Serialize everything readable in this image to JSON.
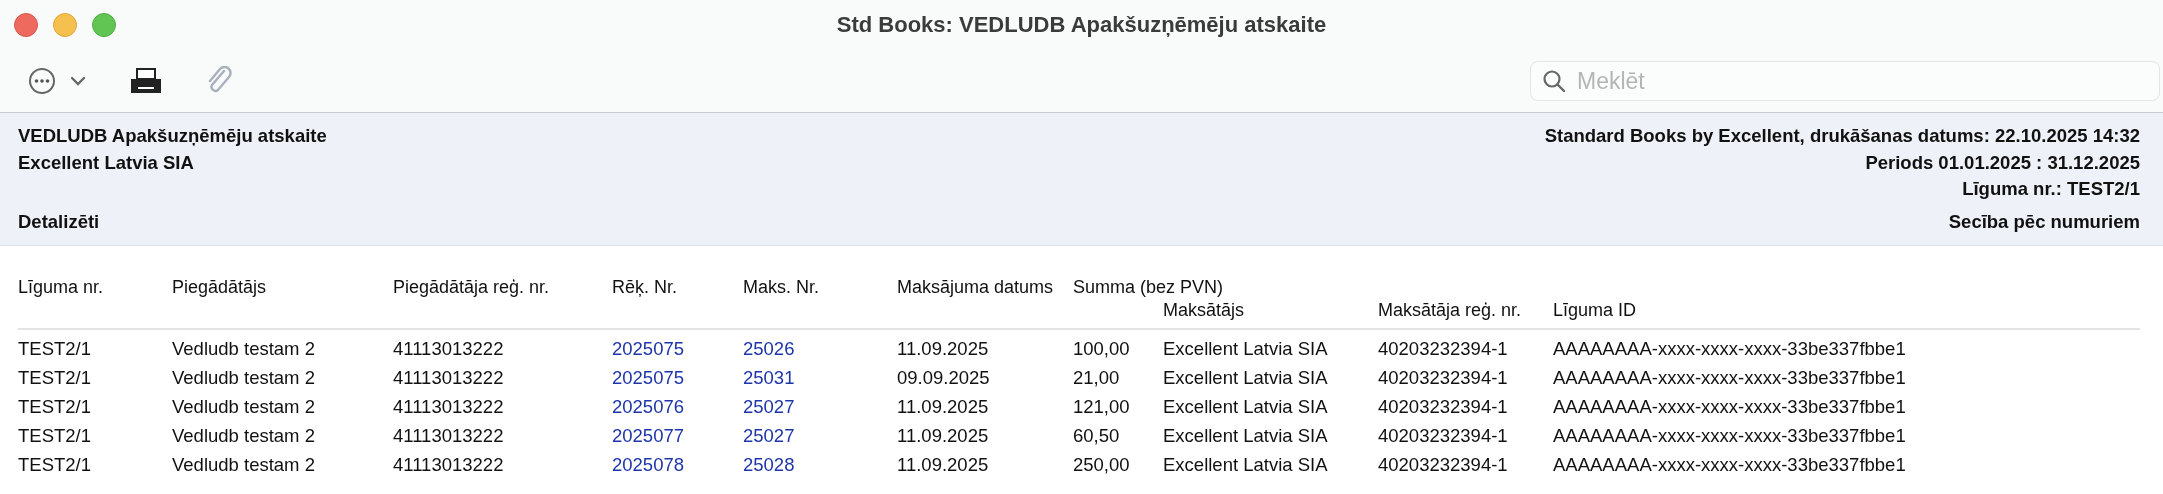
{
  "window": {
    "title": "Std Books: VEDLUDB Apakšuzņēmēju atskaite"
  },
  "toolbar": [
    {
      "kind": "more"
    },
    {
      "kind": "print"
    },
    {
      "kind": "attach"
    }
  ],
  "search": {
    "placeholder": "Meklēt"
  },
  "report_header": [
    {
      "left": "VEDLUDB Apakšuzņēmēju atskaite",
      "right": "Standard Books by Excellent, drukāšanas datums: 22.10.2025 14:32"
    },
    {
      "left": "Excellent Latvia SIA",
      "right": "Periods  01.01.2025 : 31.12.2025"
    },
    {
      "right": "Līguma nr.: TEST2/1"
    },
    {
      "left": "Detalizēti",
      "right": "Secība pēc numuriem"
    }
  ],
  "table": {
    "header_row_1": [
      "Līguma nr.",
      "Piegādātājs",
      "Piegādātāja reģ. nr.",
      "Rēķ. Nr.",
      "Maks. Nr.",
      "Maksājuma datums",
      "Summa (bez PVN)"
    ],
    "header_row_2": [
      "Maksātājs",
      "Maksātāja reģ. nr.",
      "Līguma ID"
    ],
    "rows": [
      {
        "cells": [
          {
            "kind": "text",
            "text": "TEST2/1"
          },
          {
            "kind": "text",
            "text": "Vedludb testam 2"
          },
          {
            "kind": "text",
            "text": "41113013222"
          },
          {
            "kind": "link",
            "text": "2025075"
          },
          {
            "kind": "link",
            "text": "25026"
          },
          {
            "kind": "text",
            "text": "11.09.2025"
          },
          {
            "kind": "text",
            "text": "100,00"
          },
          {
            "kind": "text",
            "text": "Excellent Latvia SIA"
          },
          {
            "kind": "text",
            "text": "40203232394-1"
          },
          {
            "kind": "text",
            "text": "AAAAAAAA-xxxx-xxxx-xxxx-33be337fbbe1"
          }
        ]
      },
      {
        "cells": [
          {
            "kind": "text",
            "text": "TEST2/1"
          },
          {
            "kind": "text",
            "text": "Vedludb testam 2"
          },
          {
            "kind": "text",
            "text": "41113013222"
          },
          {
            "kind": "link",
            "text": "2025075"
          },
          {
            "kind": "link",
            "text": "25031"
          },
          {
            "kind": "text",
            "text": "09.09.2025"
          },
          {
            "kind": "text",
            "text": "21,00"
          },
          {
            "kind": "text",
            "text": "Excellent Latvia SIA"
          },
          {
            "kind": "text",
            "text": "40203232394-1"
          },
          {
            "kind": "text",
            "text": "AAAAAAAA-xxxx-xxxx-xxxx-33be337fbbe1"
          }
        ]
      },
      {
        "cells": [
          {
            "kind": "text",
            "text": "TEST2/1"
          },
          {
            "kind": "text",
            "text": "Vedludb testam 2"
          },
          {
            "kind": "text",
            "text": "41113013222"
          },
          {
            "kind": "link",
            "text": "2025076"
          },
          {
            "kind": "link",
            "text": "25027"
          },
          {
            "kind": "text",
            "text": "11.09.2025"
          },
          {
            "kind": "text",
            "text": "121,00"
          },
          {
            "kind": "text",
            "text": "Excellent Latvia SIA"
          },
          {
            "kind": "text",
            "text": "40203232394-1"
          },
          {
            "kind": "text",
            "text": "AAAAAAAA-xxxx-xxxx-xxxx-33be337fbbe1"
          }
        ]
      },
      {
        "cells": [
          {
            "kind": "text",
            "text": "TEST2/1"
          },
          {
            "kind": "text",
            "text": "Vedludb testam 2"
          },
          {
            "kind": "text",
            "text": "41113013222"
          },
          {
            "kind": "link",
            "text": "2025077"
          },
          {
            "kind": "link",
            "text": "25027"
          },
          {
            "kind": "text",
            "text": "11.09.2025"
          },
          {
            "kind": "text",
            "text": "60,50"
          },
          {
            "kind": "text",
            "text": "Excellent Latvia SIA"
          },
          {
            "kind": "text",
            "text": "40203232394-1"
          },
          {
            "kind": "text",
            "text": "AAAAAAAA-xxxx-xxxx-xxxx-33be337fbbe1"
          }
        ]
      },
      {
        "cells": [
          {
            "kind": "text",
            "text": "TEST2/1"
          },
          {
            "kind": "text",
            "text": "Vedludb testam 2"
          },
          {
            "kind": "text",
            "text": "41113013222"
          },
          {
            "kind": "link",
            "text": "2025078"
          },
          {
            "kind": "link",
            "text": "25028"
          },
          {
            "kind": "text",
            "text": "11.09.2025"
          },
          {
            "kind": "text",
            "text": "250,00"
          },
          {
            "kind": "text",
            "text": "Excellent Latvia SIA"
          },
          {
            "kind": "text",
            "text": "40203232394-1"
          },
          {
            "kind": "text",
            "text": "AAAAAAAA-xxxx-xxxx-xxxx-33be337fbbe1"
          }
        ]
      }
    ]
  }
}
